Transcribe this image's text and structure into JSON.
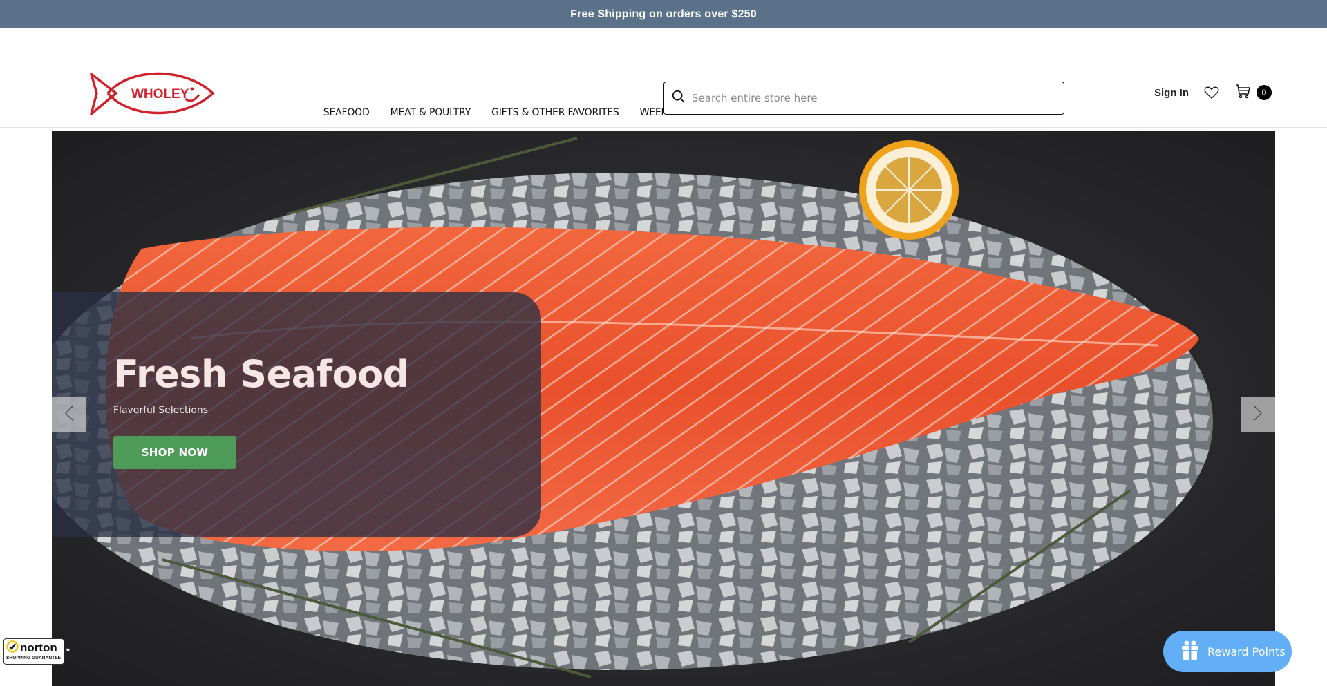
{
  "promo": {
    "text": "Free Shipping on orders over $250"
  },
  "brand": {
    "logo_text": "WHOLEY",
    "color": "#d1222b"
  },
  "search": {
    "placeholder": "Search entire store here",
    "value": ""
  },
  "header": {
    "sign_in": "Sign In",
    "cart_count": "0"
  },
  "nav": {
    "items": [
      {
        "label": "SEAFOOD"
      },
      {
        "label": "MEAT & POULTRY"
      },
      {
        "label": "GIFTS & OTHER FAVORITES"
      },
      {
        "label": "WEEKLY ONLINE SPECIALS"
      },
      {
        "label": "VISIT OUR PITTSBURGH MARKET"
      },
      {
        "label": "SERVICES"
      }
    ]
  },
  "hero": {
    "title": "Fresh Seafood",
    "subtitle": "Flavorful Selections",
    "cta": "SHOP NOW",
    "cta_color": "#4e9a58"
  },
  "norton": {
    "brand": "norton",
    "tagline": "SHOPPING GUARANTEE",
    "expand": "»"
  },
  "reward": {
    "label": "Reward Points",
    "color": "#62aef7"
  },
  "colors": {
    "promo_bg": "#5a7189"
  }
}
